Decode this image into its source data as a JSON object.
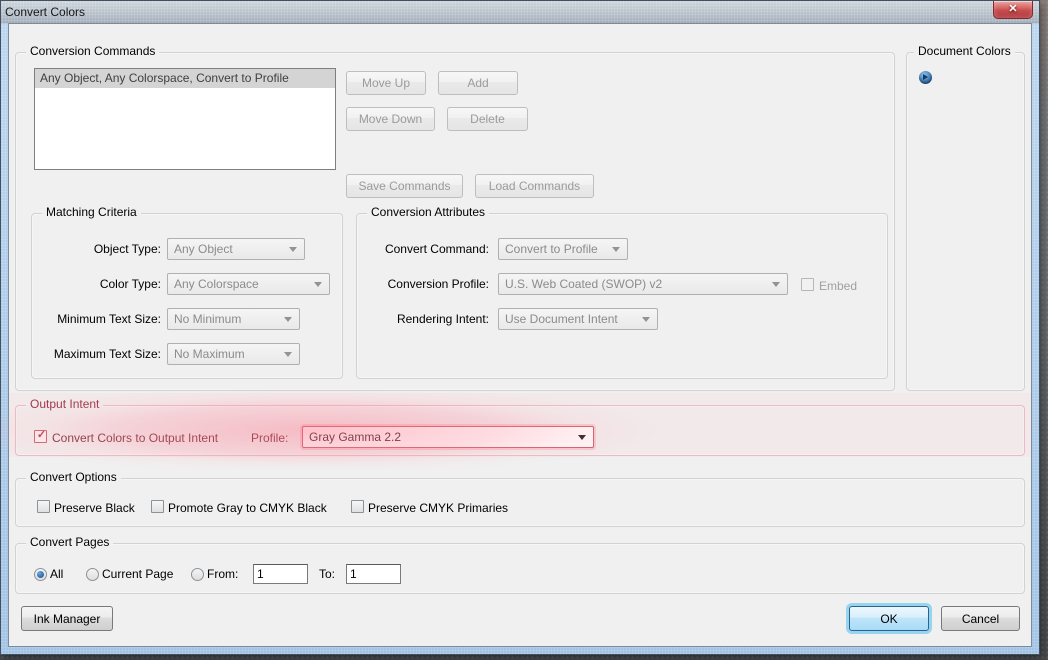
{
  "window": {
    "title": "Convert Colors",
    "close_glyph": "✕"
  },
  "conversion_commands": {
    "legend": "Conversion Commands",
    "list_items": [
      "Any Object, Any Colorspace, Convert to Profile"
    ],
    "move_up": "Move Up",
    "add": "Add",
    "move_down": "Move Down",
    "delete": "Delete",
    "save": "Save Commands",
    "load": "Load Commands"
  },
  "matching_criteria": {
    "legend": "Matching Criteria",
    "rows": [
      {
        "label": "Object Type:",
        "value": "Any Object"
      },
      {
        "label": "Color Type:",
        "value": "Any Colorspace"
      },
      {
        "label": "Minimum Text Size:",
        "value": "No Minimum"
      },
      {
        "label": "Maximum Text Size:",
        "value": "No Maximum"
      }
    ]
  },
  "conversion_attributes": {
    "legend": "Conversion Attributes",
    "rows": [
      {
        "label": "Convert Command:",
        "value": "Convert to Profile"
      },
      {
        "label": "Conversion Profile:",
        "value": "U.S. Web Coated (SWOP) v2"
      },
      {
        "label": "Rendering Intent:",
        "value": "Use Document Intent"
      }
    ],
    "embed_label": "Embed"
  },
  "document_colors": {
    "legend": "Document Colors"
  },
  "output_intent": {
    "legend": "Output Intent",
    "checkbox_label": "Convert Colors to Output Intent",
    "checkbox_checked": true,
    "check_glyph": "✓",
    "profile_label": "Profile:",
    "profile_value": "Gray Gamma 2.2"
  },
  "convert_options": {
    "legend": "Convert Options",
    "checkboxes": [
      "Preserve Black",
      "Promote Gray to CMYK Black",
      "Preserve CMYK Primaries"
    ]
  },
  "convert_pages": {
    "legend": "Convert Pages",
    "radio_all": "All",
    "radio_all_selected": true,
    "radio_current": "Current Page",
    "radio_from": "From:",
    "from_value": "1",
    "to_label": "To:",
    "to_value": "1"
  },
  "footer": {
    "ink_manager": "Ink Manager",
    "ok": "OK",
    "cancel": "Cancel"
  },
  "colors": {
    "dialog_bg": "#f0f0f0",
    "highlight_pink": "#fc8c9e",
    "ok_focus_glow": "#96d4f0",
    "close_button_red": "#c64c4e",
    "selected_radio_blue": "#2b5f9e"
  }
}
